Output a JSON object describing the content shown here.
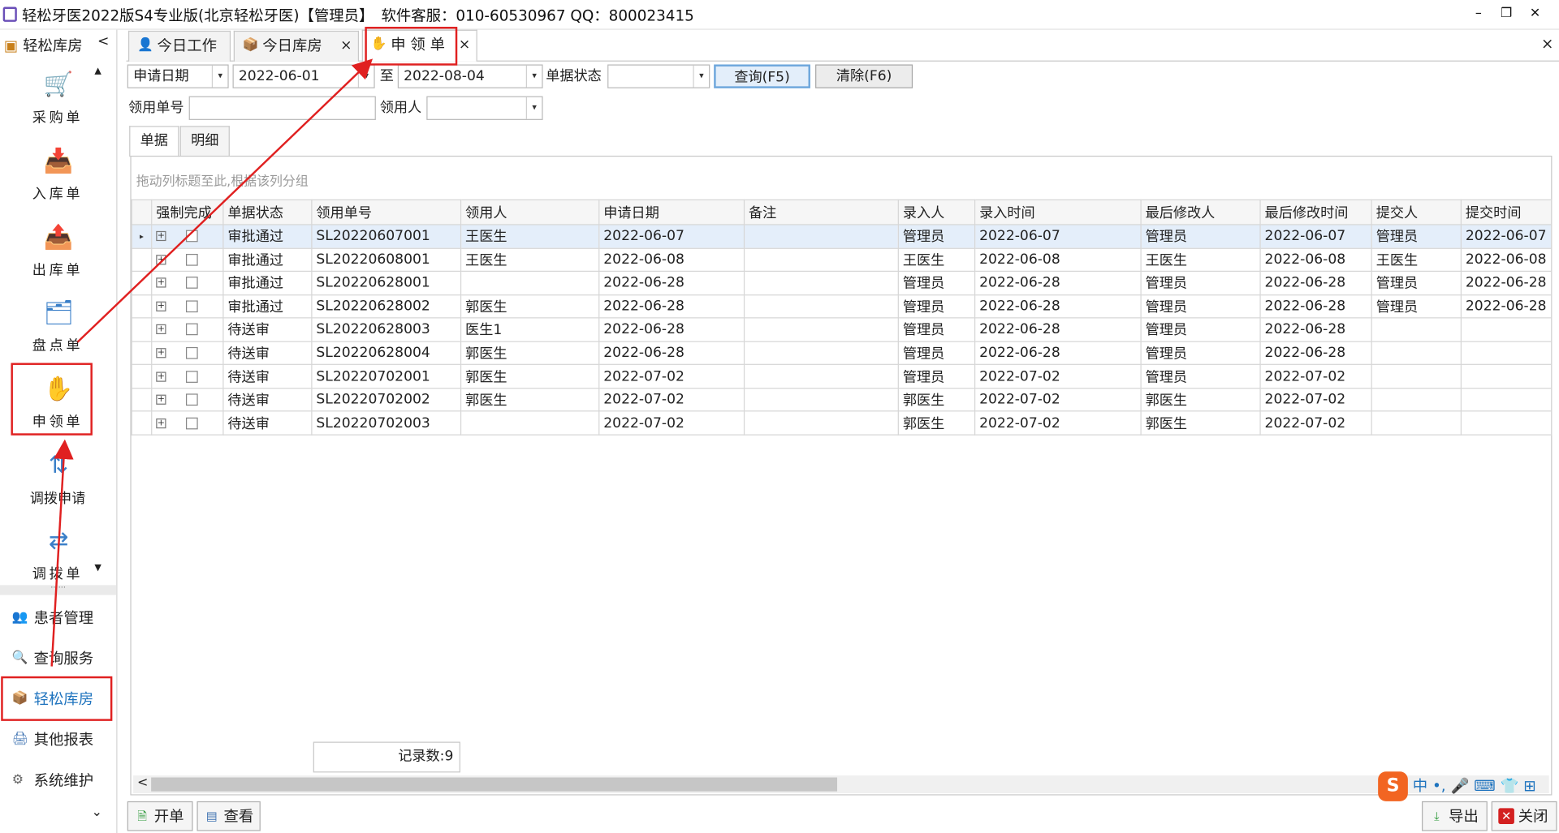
{
  "window": {
    "title": "轻松牙医2022版S4专业版(北京轻松牙医)【管理员】　软件客服：010-60530967 QQ：800023415",
    "controls": {
      "minimize": "–",
      "restore": "❐",
      "close": "✕"
    }
  },
  "sidebar": {
    "header": "轻松库房",
    "collapse_glyph": "<",
    "scroll_up": "▲",
    "scroll_down": "▼",
    "splitter": "······",
    "bottom_glyph": "⌄",
    "tools": [
      {
        "label": "采购单",
        "icon": "shopping-cart-icon"
      },
      {
        "label": "入库单",
        "icon": "inbox-down-icon"
      },
      {
        "label": "出库单",
        "icon": "inbox-up-icon"
      },
      {
        "label": "盘点单",
        "icon": "stack-icon"
      },
      {
        "label": "申领单",
        "icon": "hand-icon"
      },
      {
        "label": "调拨申请",
        "icon": "transfer-request-icon"
      },
      {
        "label": "调拨单",
        "icon": "transfer-icon"
      }
    ],
    "nav": [
      {
        "label": "患者管理",
        "icon": "patients-icon"
      },
      {
        "label": "查询服务",
        "icon": "query-icon"
      },
      {
        "label": "轻松库房",
        "icon": "warehouse-icon",
        "active": true
      },
      {
        "label": "其他报表",
        "icon": "report-icon"
      },
      {
        "label": "系统维护",
        "icon": "settings-icon"
      }
    ]
  },
  "tabs": [
    {
      "label": "今日工作",
      "icon": "person-icon",
      "closable": false
    },
    {
      "label": "今日库房",
      "icon": "box-icon",
      "closable": true
    },
    {
      "label": "申 领 单",
      "icon": "hand-icon",
      "closable": true,
      "active": true
    }
  ],
  "tab_close_all": "×",
  "tab_close": "×",
  "filter": {
    "date_type": "申请日期",
    "date_from": "2022-06-01",
    "to_label": "至",
    "date_to": "2022-08-04",
    "status_label": "单据状态",
    "status_value": "",
    "query_button": "查询(F5)",
    "clear_button": "清除(F6)",
    "req_no_label": "领用单号",
    "req_no_value": "",
    "requester_label": "领用人",
    "requester_value": "",
    "dropdown_glyph": "▾"
  },
  "subtabs": [
    "单据",
    "明细"
  ],
  "grid": {
    "group_hint": "拖动列标题至此,根据该列分组",
    "columns": [
      "强制完成",
      "单据状态",
      "领用单号",
      "领用人",
      "申请日期",
      "备注",
      "录入人",
      "录入时间",
      "最后修改人",
      "最后修改时间",
      "提交人",
      "提交时间"
    ],
    "expander_glyph": "+",
    "row_indicator": "▸",
    "rows": [
      [
        "",
        "审批通过",
        "SL20220607001",
        "王医生",
        "2022-06-07",
        "",
        "管理员",
        "2022-06-07",
        "管理员",
        "2022-06-07",
        "管理员",
        "2022-06-07"
      ],
      [
        "",
        "审批通过",
        "SL20220608001",
        "王医生",
        "2022-06-08",
        "",
        "王医生",
        "2022-06-08",
        "王医生",
        "2022-06-08",
        "王医生",
        "2022-06-08"
      ],
      [
        "",
        "审批通过",
        "SL20220628001",
        "",
        "2022-06-28",
        "",
        "管理员",
        "2022-06-28",
        "管理员",
        "2022-06-28",
        "管理员",
        "2022-06-28"
      ],
      [
        "",
        "审批通过",
        "SL20220628002",
        "郭医生",
        "2022-06-28",
        "",
        "管理员",
        "2022-06-28",
        "管理员",
        "2022-06-28",
        "管理员",
        "2022-06-28"
      ],
      [
        "",
        "待送审",
        "SL20220628003",
        "医生1",
        "2022-06-28",
        "",
        "管理员",
        "2022-06-28",
        "管理员",
        "2022-06-28",
        "",
        ""
      ],
      [
        "",
        "待送审",
        "SL20220628004",
        "郭医生",
        "2022-06-28",
        "",
        "管理员",
        "2022-06-28",
        "管理员",
        "2022-06-28",
        "",
        ""
      ],
      [
        "",
        "待送审",
        "SL20220702001",
        "郭医生",
        "2022-07-02",
        "",
        "管理员",
        "2022-07-02",
        "管理员",
        "2022-07-02",
        "",
        ""
      ],
      [
        "",
        "待送审",
        "SL20220702002",
        "郭医生",
        "2022-07-02",
        "",
        "郭医生",
        "2022-07-02",
        "郭医生",
        "2022-07-02",
        "",
        ""
      ],
      [
        "",
        "待送审",
        "SL20220702003",
        "",
        "2022-07-02",
        "",
        "郭医生",
        "2022-07-02",
        "郭医生",
        "2022-07-02",
        "",
        ""
      ]
    ],
    "record_count": "记录数:9",
    "scroll_left": "<"
  },
  "footer": {
    "open_button": "开单",
    "view_button": "查看",
    "export_button": "导出",
    "close_button": "关闭"
  },
  "ime": {
    "logo": "S",
    "mode": "中",
    "items": "•, 🎤 ⌨ 👕 ⊞"
  },
  "colors": {
    "annotation_red": "#e02020",
    "selected_row": "#e4eefa",
    "accent_blue": "#1e73be"
  }
}
